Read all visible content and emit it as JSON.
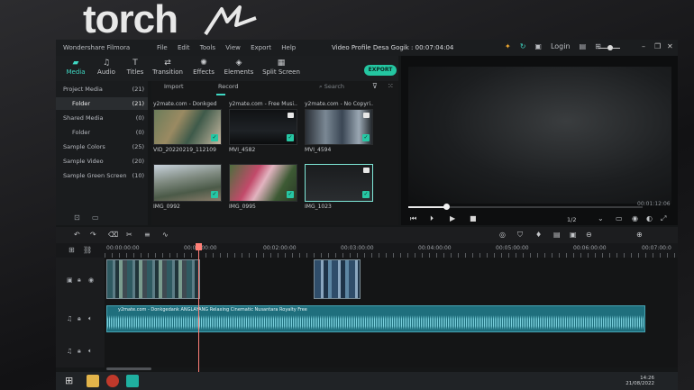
{
  "brand": {
    "logo": "torch"
  },
  "app": {
    "name": "Wondershare Filmora",
    "menu": [
      "File",
      "Edit",
      "Tools",
      "View",
      "Export",
      "Help"
    ],
    "project_title": "Video Profile Desa Gogik : 00:07:04:04",
    "login_label": "Login"
  },
  "toolbar": {
    "items": [
      {
        "label": "Media",
        "icon": "folder-icon"
      },
      {
        "label": "Audio",
        "icon": "music-icon"
      },
      {
        "label": "Titles",
        "icon": "text-icon"
      },
      {
        "label": "Transition",
        "icon": "transition-icon"
      },
      {
        "label": "Effects",
        "icon": "effects-icon"
      },
      {
        "label": "Elements",
        "icon": "elements-icon"
      },
      {
        "label": "Split Screen",
        "icon": "split-screen-icon"
      }
    ],
    "export_label": "EXPORT"
  },
  "sidebar": {
    "items": [
      {
        "label": "Project Media",
        "count": "(21)"
      },
      {
        "label": "Folder",
        "count": "(21)"
      },
      {
        "label": "Shared Media",
        "count": "(0)"
      },
      {
        "label": "Folder",
        "count": "(0)"
      },
      {
        "label": "Sample Colors",
        "count": "(25)"
      },
      {
        "label": "Sample Video",
        "count": "(20)"
      },
      {
        "label": "Sample Green Screen",
        "count": "(10)"
      }
    ]
  },
  "media": {
    "import_label": "Import",
    "record_label": "Record",
    "search_placeholder": "Search",
    "cards": [
      {
        "title": "y2mate.com - Donkged",
        "caption": "VID_20220219_112109"
      },
      {
        "title": "y2mate.com - Free Musi...",
        "caption": "MVI_4582"
      },
      {
        "title": "y2mate.com - No Copyri...",
        "caption": "MVI_4594"
      },
      {
        "title": "",
        "caption": "IMG_0992"
      },
      {
        "title": "",
        "caption": "IMG_0995"
      },
      {
        "title": "",
        "caption": "IMG_1023"
      }
    ]
  },
  "preview": {
    "progress": 0.16,
    "time": "00:01:12:06",
    "ratio": "1/2"
  },
  "timeline": {
    "ruler": [
      "00:00:00:00",
      "00:01:00:00",
      "00:02:00:00",
      "00:03:00:00",
      "00:04:00:00",
      "00:05:00:00",
      "00:06:00:00",
      "00:07:00:0"
    ],
    "audio_clip_name": "y2mate.com - Donkgedank ANGLAYANG Relaxing Cinematic Nusantara Royalty Free"
  },
  "taskbar": {
    "time": "14:26",
    "date": "21/08/2022"
  },
  "colors": {
    "accent": "#3fd8c3",
    "export": "#24c6a1",
    "playhead": "#ff7f77",
    "audio": "#1f6f7d"
  }
}
